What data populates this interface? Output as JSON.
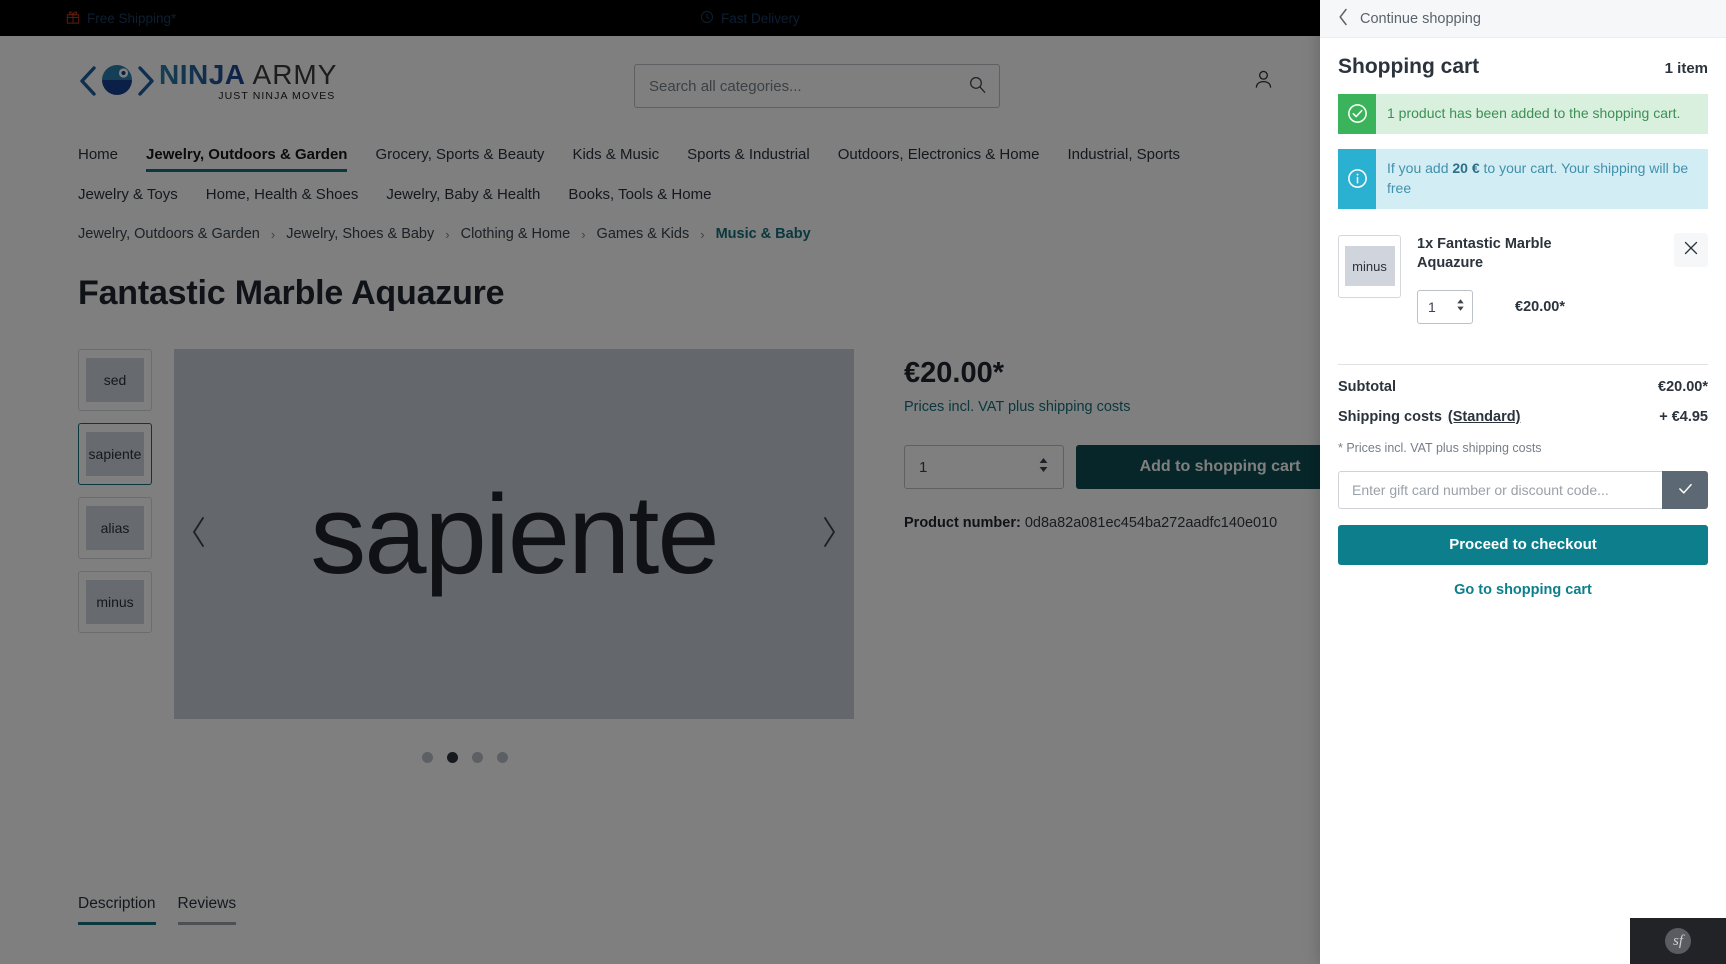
{
  "topbar": {
    "items": [
      {
        "icon": "gift-icon",
        "label": "Free Shipping*"
      },
      {
        "icon": "clock-icon",
        "label": "Fast Delivery"
      }
    ]
  },
  "header": {
    "logo": {
      "brand": "NINJA",
      "brand2": "ARMY",
      "tagline": "JUST NINJA MOVES"
    },
    "search": {
      "value": "",
      "placeholder": "Search all categories...",
      "icon": "search-icon"
    },
    "account_icon": "user-icon"
  },
  "nav": {
    "primary": [
      "Home",
      "Jewelry, Outdoors & Garden",
      "Grocery, Sports & Beauty",
      "Kids & Music",
      "Sports & Industrial",
      "Outdoors, Electronics & Home",
      "Industrial, Sports"
    ],
    "active_index": 1,
    "secondary": [
      "Jewelry & Toys",
      "Home, Health & Shoes",
      "Jewelry, Baby & Health",
      "Books, Tools & Home"
    ]
  },
  "breadcrumb": {
    "items": [
      "Jewelry, Outdoors & Garden",
      "Jewelry, Shoes & Baby",
      "Clothing & Home",
      "Games & Kids",
      "Music & Baby"
    ],
    "separator": "›"
  },
  "product": {
    "title": "Fantastic Marble Aquazure",
    "price": "€20.00*",
    "price_note": "Prices incl. VAT plus shipping costs",
    "quantity": "1",
    "add_to_cart_label": "Add to shopping cart",
    "product_number_label": "Product number:",
    "product_number": "0d8a82a081ec454ba272aadfc140e010",
    "gallery": {
      "thumbnails": [
        "sed",
        "sapiente",
        "alias",
        "minus"
      ],
      "selected_index": 1,
      "main_label": "sapiente",
      "dots": 4,
      "active_dot": 1,
      "prev_icon": "chevron-left-icon",
      "next_icon": "chevron-right-icon"
    },
    "tabs": [
      {
        "label": "Description",
        "active": true
      },
      {
        "label": "Reviews",
        "active": false
      }
    ]
  },
  "cart": {
    "back_label": "Continue shopping",
    "back_icon": "chevron-left-icon",
    "title": "Shopping cart",
    "count": "1 item",
    "alerts": [
      {
        "type": "success",
        "icon": "check-circle-icon",
        "text": "1 product has been added to the shopping cart."
      },
      {
        "type": "info",
        "icon": "info-circle-icon",
        "text_before": "If you add ",
        "text_bold": "20 €",
        "text_after": " to your cart. Your shipping will be free"
      }
    ],
    "item": {
      "thumb_label": "minus",
      "name": "1x Fantastic Marble Aquazure",
      "quantity": "1",
      "price": "€20.00*",
      "remove_icon": "close-icon"
    },
    "summary": [
      {
        "label": "Subtotal",
        "link": "",
        "value": "€20.00*"
      },
      {
        "label": "Shipping costs",
        "link": "(Standard)",
        "value": "+ €4.95"
      }
    ],
    "vat_note": "* Prices incl. VAT plus shipping costs",
    "promo": {
      "value": "",
      "placeholder": "Enter gift card number or discount code...",
      "submit_icon": "check-icon"
    },
    "checkout_label": "Proceed to checkout",
    "goto_cart_label": "Go to shopping cart"
  },
  "devbar": {
    "badge": "sf"
  },
  "colors": {
    "accent": "#15707c",
    "checkout": "#0d7f8c",
    "cart_button": "#0c4d53",
    "success": "#3ab35a",
    "info": "#2ab0d0"
  }
}
